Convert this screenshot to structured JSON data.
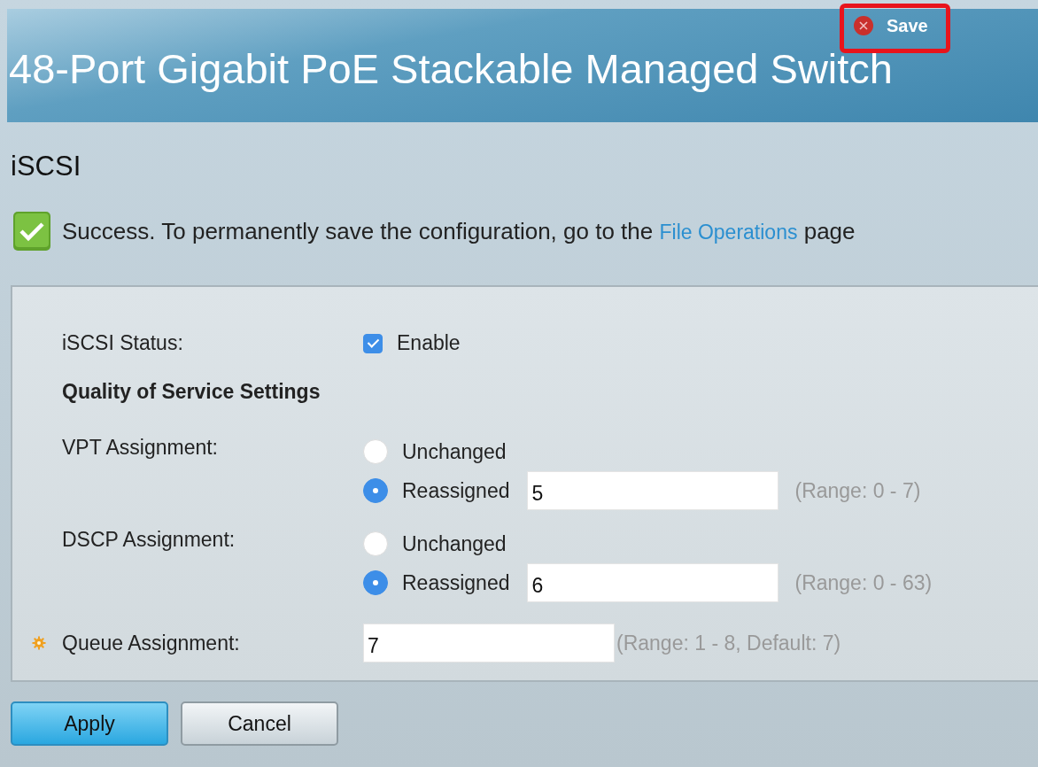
{
  "header": {
    "title": "48-Port Gigabit PoE Stackable Managed Switch",
    "save_label": "Save",
    "save_highlighted": true
  },
  "page_title": "iSCSI",
  "message": {
    "text": "Success. To permanently save the configuration, go to the",
    "link": "File Operations",
    "suffix": "page"
  },
  "form": {
    "status": {
      "label": "iSCSI Status:",
      "checked": true,
      "option": "Enable"
    },
    "section_title": "Quality of Service Settings",
    "assignments": [
      {
        "label": "VPT Assignment:",
        "options": [
          {
            "label": "Unchanged",
            "selected": false
          },
          {
            "label": "Reassigned",
            "selected": true
          }
        ],
        "value": "5",
        "hint": "(Range: 0 - 7)"
      },
      {
        "label": "DSCP Assignment:",
        "options": [
          {
            "label": "Unchanged",
            "selected": false
          },
          {
            "label": "Reassigned",
            "selected": true
          }
        ],
        "value": "6",
        "hint": "(Range: 0 - 63)"
      }
    ],
    "queue": {
      "label": "Queue Assignment:",
      "value": "7",
      "hint": "(Range: 1 - 8, Default: 7)"
    }
  },
  "buttons": [
    {
      "label": "Apply",
      "kind": "primary"
    },
    {
      "label": "Cancel",
      "kind": "secondary"
    }
  ]
}
